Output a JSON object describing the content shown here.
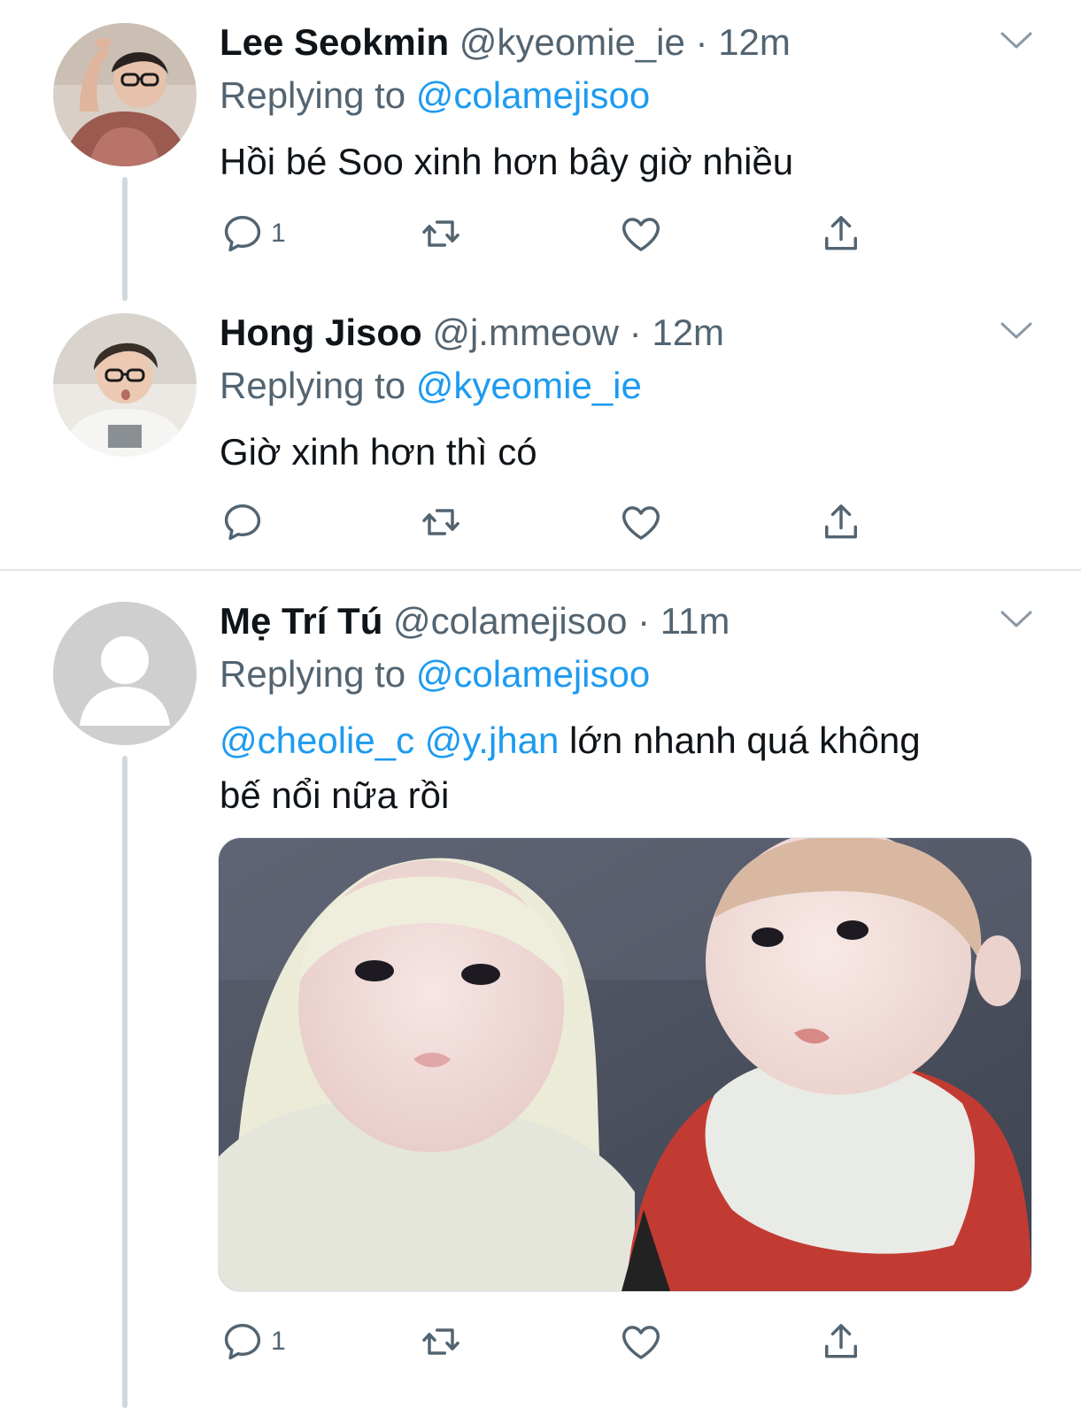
{
  "tweets": [
    {
      "name": "Lee Seokmin",
      "handle": "@kyeomie_ie",
      "sep": "·",
      "time": "12m",
      "replying_label": "Replying to",
      "replying_to": "@colamejisoo",
      "text": "Hồi bé Soo xinh hơn bây giờ nhiều",
      "reply_count": "1"
    },
    {
      "name": "Hong Jisoo",
      "handle": "@j.mmeow",
      "sep": "·",
      "time": "12m",
      "replying_label": "Replying to",
      "replying_to": "@kyeomie_ie",
      "text": "Giờ xinh hơn thì có"
    },
    {
      "name": "Mẹ Trí Tú",
      "handle": "@colamejisoo",
      "sep": "·",
      "time": "11m",
      "replying_label": "Replying to",
      "replying_to": "@colamejisoo",
      "mention_1": "@cheolie_c",
      "mention_2": "@y.jhan",
      "text_line1": "lớn nhanh quá không",
      "text_line2": "bế nổi nữa rồi",
      "reply_count": "1"
    }
  ],
  "colors": {
    "accent": "#1d9bf0",
    "muted": "#536471",
    "thread": "#cfd9de"
  },
  "icons": [
    "reply-icon",
    "retweet-icon",
    "like-icon",
    "share-icon",
    "chevron-down-icon",
    "default-avatar-icon"
  ]
}
